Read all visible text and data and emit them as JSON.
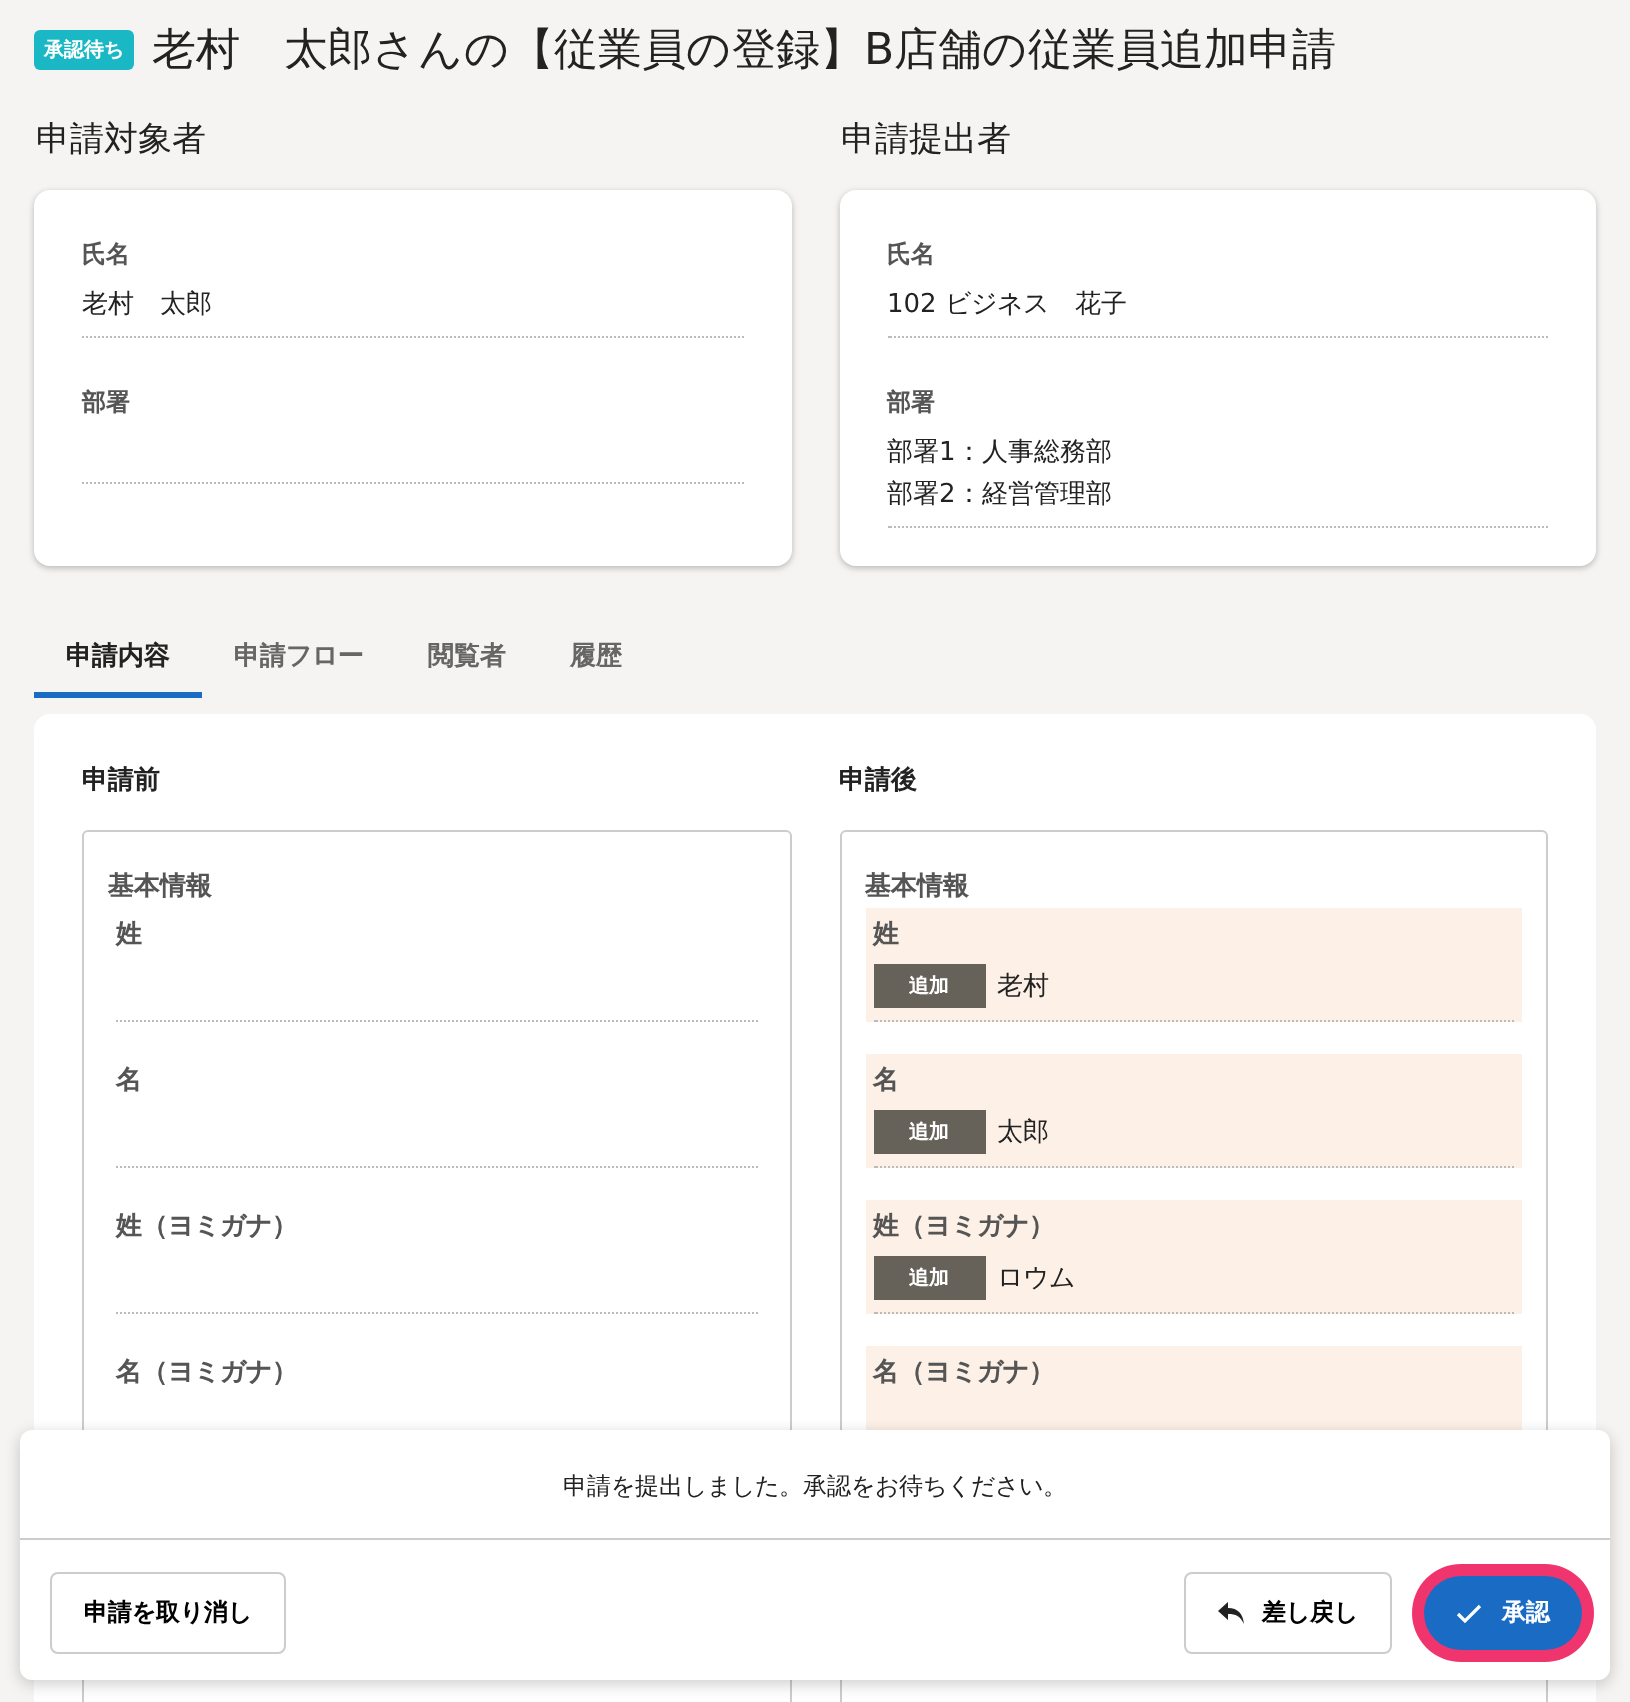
{
  "header": {
    "status_badge": "承認待ち",
    "title": "老村　太郎さんの【従業員の登録】B店舗の従業員追加申請"
  },
  "target": {
    "heading": "申請対象者",
    "fields": [
      {
        "label": "氏名",
        "values": [
          "老村　太郎"
        ]
      },
      {
        "label": "部署"
      }
    ]
  },
  "submitter": {
    "heading": "申請提出者",
    "fields": [
      {
        "label": "氏名",
        "values": [
          "102 ビジネス　花子"
        ]
      },
      {
        "label": "部署",
        "values": [
          "部署1：人事総務部",
          "部署2：経営管理部"
        ]
      }
    ]
  },
  "tabs": [
    {
      "label": "申請内容",
      "selected": true
    },
    {
      "label": "申請フロー",
      "selected": false
    },
    {
      "label": "閲覧者",
      "selected": false
    },
    {
      "label": "履歴",
      "selected": false
    }
  ],
  "before": {
    "heading": "申請前",
    "section": "基本情報",
    "fields": [
      {
        "label": "姓",
        "changed": false
      },
      {
        "label": "名",
        "changed": false
      },
      {
        "label": "姓（ヨミガナ）",
        "changed": false
      },
      {
        "label": "名（ヨミガナ）",
        "changed": false
      }
    ]
  },
  "after": {
    "heading": "申請後",
    "section": "基本情報",
    "fields": [
      {
        "label": "姓",
        "changed": true,
        "tag": "追加",
        "value": "老村"
      },
      {
        "label": "名",
        "changed": true,
        "tag": "追加",
        "value": "太郎"
      },
      {
        "label": "姓（ヨミガナ）",
        "changed": true,
        "tag": "追加",
        "value": "ロウム"
      },
      {
        "label": "名（ヨミガナ）",
        "changed": true
      }
    ]
  },
  "footer": {
    "message": "申請を提出しました。承認をお待ちください。",
    "cancel_button": "申請を取り消し",
    "return_button": "差し戻し",
    "approve_button": "承認",
    "approve_focused": true
  }
}
